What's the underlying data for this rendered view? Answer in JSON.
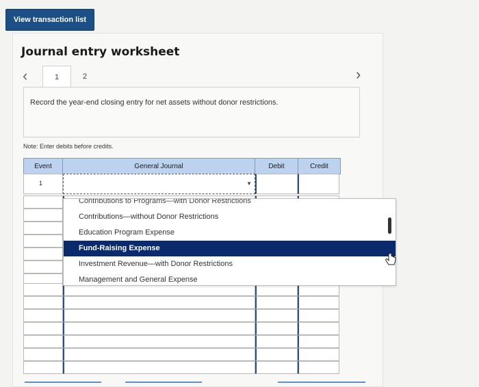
{
  "top_button": {
    "label": "View transaction list"
  },
  "worksheet": {
    "title": "Journal entry worksheet",
    "tabs": [
      "1",
      "2"
    ],
    "active_tab": "1",
    "instruction": "Record the year-end closing entry for net assets without donor restrictions.",
    "note": "Note: Enter debits before credits."
  },
  "table": {
    "headers": {
      "event": "Event",
      "general_journal": "General Journal",
      "debit": "Debit",
      "credit": "Credit"
    },
    "row1_event": "1"
  },
  "dropdown": {
    "partial_option": "Contributions to Programs—with Donor Restrictions",
    "options": [
      "Contributions—without Donor Restrictions",
      "Education Program Expense",
      "Fund-Raising Expense",
      "Investment Revenue—with Donor Restrictions",
      "Management and General Expense"
    ],
    "selected": "Fund-Raising Expense"
  },
  "colors": {
    "button": "#1c4f86",
    "header": "#bcd2ef",
    "selected": "#0b2a6e"
  }
}
